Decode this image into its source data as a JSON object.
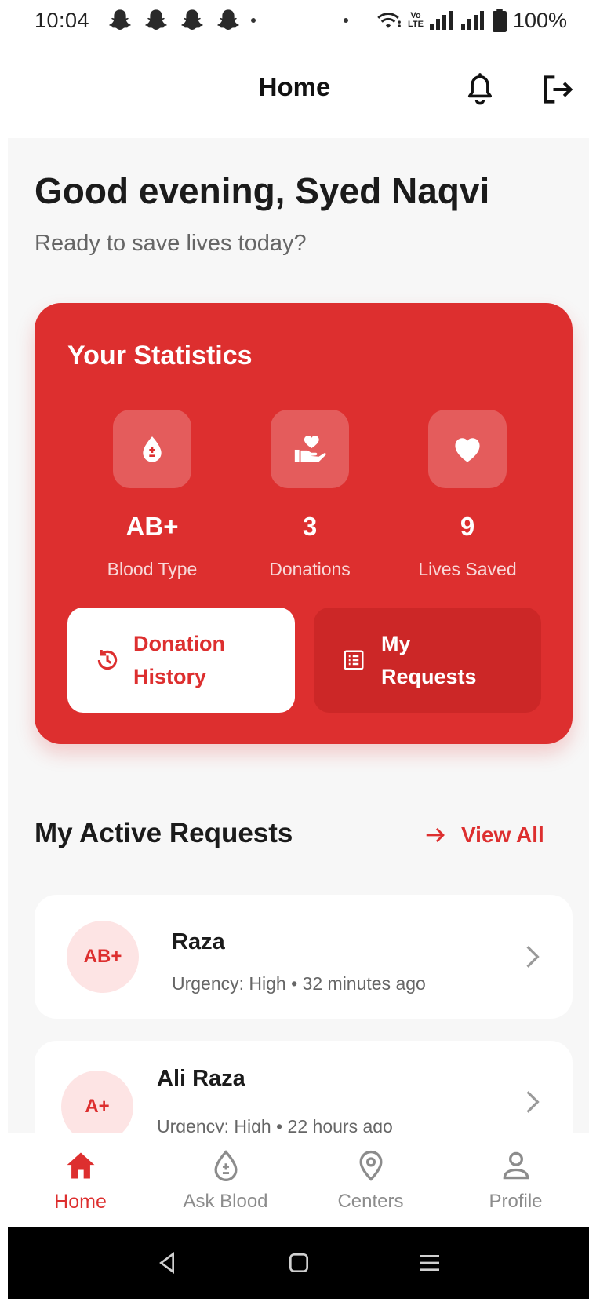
{
  "status_bar": {
    "time": "10:04",
    "battery": "100%",
    "network_tag_top": "Vo",
    "network_tag_bottom": "LTE"
  },
  "app_bar": {
    "title": "Home",
    "icons": [
      "bell-icon",
      "logout-icon"
    ]
  },
  "greeting": {
    "title": "Good evening, Syed Naqvi",
    "subtitle": "Ready to save lives today?"
  },
  "stats": {
    "title": "Your Statistics",
    "items": [
      {
        "icon": "blood-drop-icon",
        "value": "AB+",
        "label": "Blood Type"
      },
      {
        "icon": "hand-heart-icon",
        "value": "3",
        "label": "Donations"
      },
      {
        "icon": "heart-icon",
        "value": "9",
        "label": "Lives Saved"
      }
    ],
    "history_button": {
      "line1": "Donation",
      "line2": "History"
    },
    "requests_button": {
      "line1": "My",
      "line2": "Requests"
    }
  },
  "active_requests": {
    "title": "My Active Requests",
    "view_all": "View All",
    "items": [
      {
        "blood_type": "AB+",
        "name": "Raza",
        "meta": "Urgency: High • 32 minutes ago"
      },
      {
        "blood_type": "A+",
        "name": "Ali Raza",
        "meta": "Urgency: High • 22 hours ago"
      }
    ]
  },
  "bottom_nav": {
    "items": [
      {
        "label": "Home",
        "icon": "home-icon",
        "active": true
      },
      {
        "label": "Ask Blood",
        "icon": "blood-drop-icon",
        "active": false
      },
      {
        "label": "Centers",
        "icon": "location-pin-icon",
        "active": false
      },
      {
        "label": "Profile",
        "icon": "person-icon",
        "active": false
      }
    ]
  },
  "colors": {
    "accent": "#dd2f2f",
    "badge_bg": "#fde4e4",
    "background": "#f7f7f7"
  }
}
